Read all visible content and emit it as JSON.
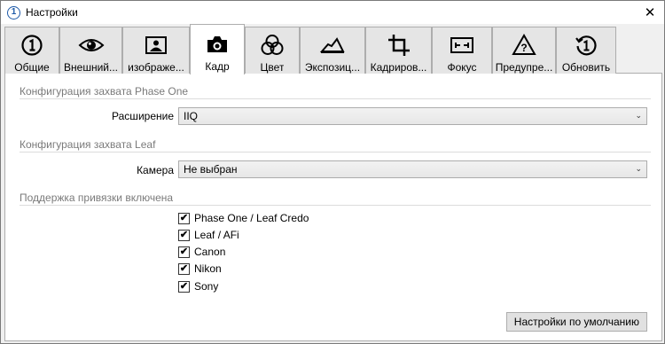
{
  "window": {
    "title": "Настройки",
    "close_glyph": "✕"
  },
  "tabs": [
    {
      "label": "Общие",
      "icon": "info-one-icon"
    },
    {
      "label": "Внешний...",
      "icon": "eye-icon"
    },
    {
      "label": "изображе...",
      "icon": "image-icon"
    },
    {
      "label": "Кадр",
      "icon": "camera-icon",
      "active": true
    },
    {
      "label": "Цвет",
      "icon": "color-circles-icon"
    },
    {
      "label": "Экспозиц...",
      "icon": "exposure-icon"
    },
    {
      "label": "Кадриров...",
      "icon": "crop-icon"
    },
    {
      "label": "Фокус",
      "icon": "focus-icon"
    },
    {
      "label": "Предупре...",
      "icon": "warning-icon"
    },
    {
      "label": "Обновить",
      "icon": "update-icon"
    }
  ],
  "phase_one": {
    "header": "Конфигурация захвата Phase One",
    "extension_label": "Расширение",
    "extension_value": "IIQ"
  },
  "leaf": {
    "header": "Конфигурация захвата Leaf",
    "camera_label": "Камера",
    "camera_value": "Не выбран"
  },
  "tethering": {
    "header": "Поддержка привязки включена",
    "items": [
      {
        "label": "Phase One / Leaf Credo",
        "checked": true
      },
      {
        "label": "Leaf / AFi",
        "checked": true
      },
      {
        "label": "Canon",
        "checked": true
      },
      {
        "label": "Nikon",
        "checked": true
      },
      {
        "label": "Sony",
        "checked": true
      }
    ],
    "check_glyph": "✔"
  },
  "footer": {
    "defaults_button": "Настройки по умолчанию"
  }
}
